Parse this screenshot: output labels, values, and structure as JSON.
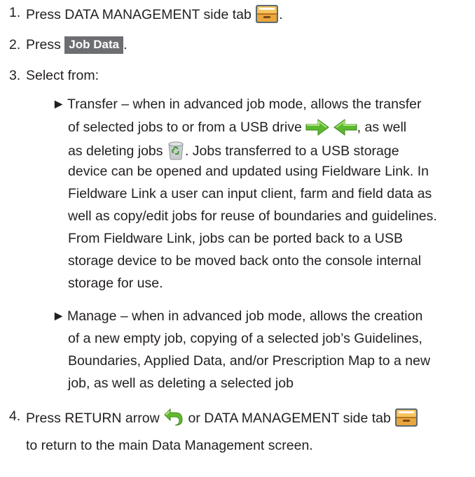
{
  "bullet_glyph": "►",
  "steps": [
    {
      "number": "1.",
      "text": "Press DATA MANAGEMENT side tab",
      "after": "."
    },
    {
      "number": "2.",
      "text": "Press",
      "button": "Job Data",
      "after": "."
    },
    {
      "number": "3.",
      "text": "Select from:"
    },
    {
      "number": "4.",
      "text": "Press RETURN arrow",
      "middle": "or DATA MANAGEMENT side tab",
      "line2": "to return to the main Data Management screen."
    }
  ],
  "transfer": {
    "lines": {
      "0": "Transfer – when in advanced job mode, allows the transfer",
      "1": "of selected jobs to or from a USB drive",
      "1b": ", as well",
      "2": "as deleting jobs",
      "2b": ". Jobs transferred to a USB storage",
      "3": "device can be opened and updated using Fieldware Link. In",
      "4": "Fieldware Link a user can input client, farm and field data as",
      "5": "well as copy/edit jobs for reuse of boundaries and guidelines.",
      "6": "From Fieldware Link, jobs can be ported back to a USB",
      "7": "storage device to be moved back onto the console internal",
      "8": "storage for use."
    }
  },
  "manage": {
    "lines": [
      "Manage – when in advanced job mode, allows the creation",
      "of a new empty job, copying of a selected job’s Guidelines,",
      "Boundaries, Applied Data, and/or Prescription Map to a new",
      "job, as well as deleting a selected job"
    ]
  }
}
